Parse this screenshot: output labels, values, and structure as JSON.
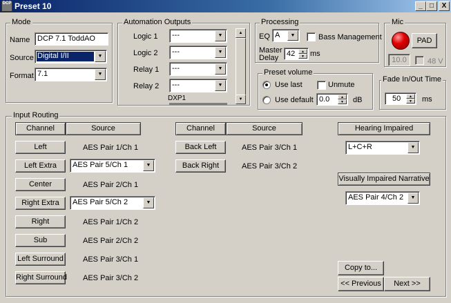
{
  "window": {
    "title": "Preset 10",
    "app_icon_text": "DCP",
    "buttons": {
      "minimize": "_",
      "maximize": "□",
      "close": "X"
    }
  },
  "mode": {
    "legend": "Mode",
    "name_label": "Name",
    "name_value": "DCP 7.1 ToddAO",
    "source_label": "Source",
    "source_value": "Digital I/II",
    "format_label": "Format",
    "format_value": "7.1"
  },
  "automation": {
    "legend": "Automation Outputs",
    "rows": [
      {
        "label": "Logic 1",
        "value": "---"
      },
      {
        "label": "Logic 2",
        "value": "---"
      },
      {
        "label": "Relay 1",
        "value": "---"
      },
      {
        "label": "Relay 2",
        "value": "---"
      }
    ],
    "partial_label": "DXP1"
  },
  "processing": {
    "legend": "Processing",
    "eq_label": "EQ",
    "eq_value": "A",
    "bass_management_label": "Bass Management",
    "master_delay_label_1": "Master",
    "master_delay_label_2": "Delay",
    "master_delay_value": "42",
    "master_delay_unit": "ms"
  },
  "mic": {
    "legend": "Mic",
    "pad_label": "PAD",
    "level_value": "10.0",
    "phantom_label": "48 V"
  },
  "preset_volume": {
    "legend": "Preset volume",
    "use_last_label": "Use last",
    "use_default_label": "Use default",
    "unmute_label": "Unmute",
    "default_value": "0.0",
    "unit": "dB"
  },
  "fade": {
    "legend": "Fade In/Out Time",
    "value": "50",
    "unit": "ms"
  },
  "routing": {
    "legend": "Input Routing",
    "channel_header": "Channel",
    "source_header": "Source",
    "left_rows": [
      {
        "channel": "Left",
        "source": "AES Pair 1/Ch 1",
        "combo": false
      },
      {
        "channel": "Left Extra",
        "source": "AES Pair 5/Ch 1",
        "combo": true
      },
      {
        "channel": "Center",
        "source": "AES Pair 2/Ch 1",
        "combo": false
      },
      {
        "channel": "Right Extra",
        "source": "AES Pair 5/Ch 2",
        "combo": true
      },
      {
        "channel": "Right",
        "source": "AES Pair 1/Ch 2",
        "combo": false
      },
      {
        "channel": "Sub",
        "source": "AES Pair 2/Ch 2",
        "combo": false
      },
      {
        "channel": "Left Surround",
        "source": "AES Pair 3/Ch 1",
        "combo": false
      },
      {
        "channel": "Right Surround",
        "source": "AES Pair 3/Ch 2",
        "combo": false
      }
    ],
    "right_rows": [
      {
        "channel": "Back Left",
        "source": "AES Pair 3/Ch 1"
      },
      {
        "channel": "Back Right",
        "source": "AES Pair 3/Ch 2"
      }
    ],
    "hearing_impaired_label": "Hearing Impaired",
    "hearing_impaired_value": "L+C+R",
    "visually_impaired_label": "Visually Impaired Narrative",
    "visually_impaired_value": "AES Pair 4/Ch 2"
  },
  "footer": {
    "copy_label": "Copy to...",
    "previous_label": "<< Previous",
    "next_label": "Next >>"
  }
}
